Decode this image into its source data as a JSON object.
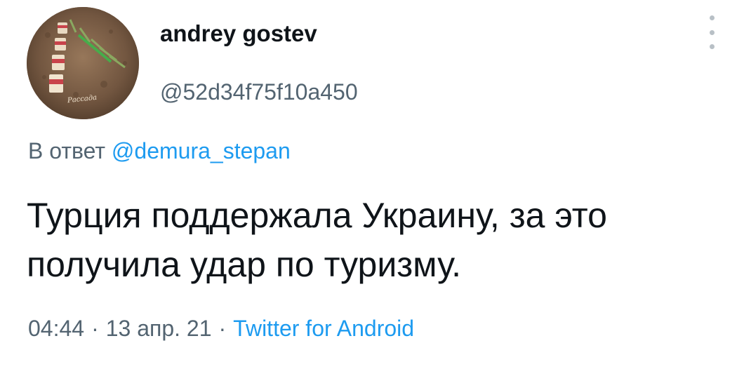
{
  "author": {
    "display_name": "andrey gostev",
    "handle": "@52d34f75f10a450",
    "avatar": {
      "caption": "Рассада",
      "description": "photo-avatar"
    }
  },
  "menu": {
    "icon": "more-vertical-icon"
  },
  "reply": {
    "prefix": "В ответ",
    "to_handle": "@demura_stepan"
  },
  "tweet": {
    "text": "Турция поддержала Украину, за это получила удар по туризму.",
    "time": "04:44",
    "date": "13 апр. 21",
    "source": "Twitter for Android",
    "separator": "·"
  },
  "colors": {
    "link": "#1d9bf0",
    "secondary_text": "#536471",
    "primary_text": "#0f1419",
    "menu_dots": "#b8c0c6"
  }
}
